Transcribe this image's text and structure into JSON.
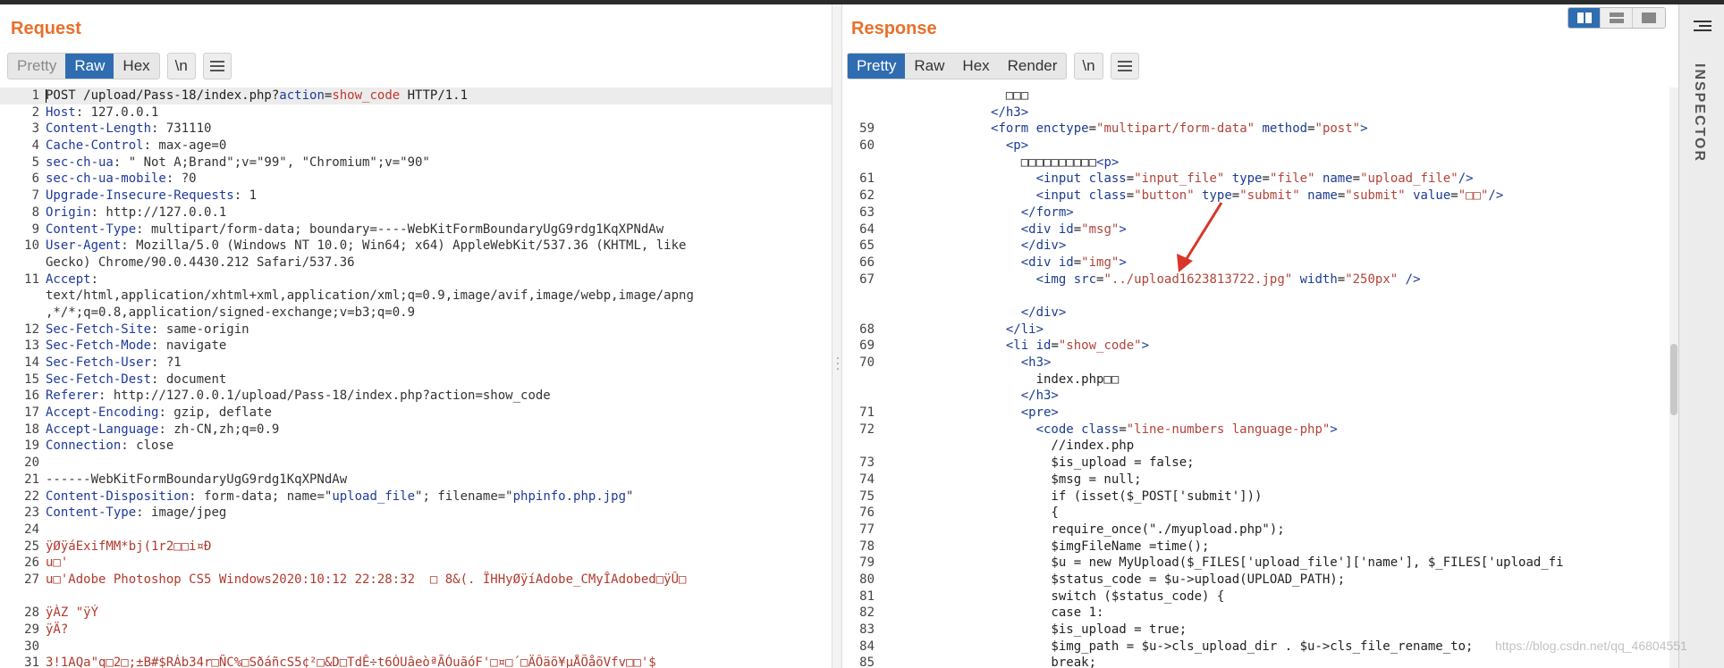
{
  "layout_buttons": [
    {
      "name": "split-horizontal",
      "active": true
    },
    {
      "name": "split-vertical",
      "active": false
    },
    {
      "name": "single",
      "active": false
    }
  ],
  "inspector": {
    "label": "INSPECTOR"
  },
  "request": {
    "title": "Request",
    "tabs": [
      "Pretty",
      "Raw",
      "Hex"
    ],
    "active_tab": "Raw",
    "newline_btn": "\\n",
    "lines": [
      {
        "n": "1",
        "hl": true,
        "cursor": true,
        "segs": [
          [
            "plain",
            "POST /upload/Pass-18/index.php?"
          ],
          [
            "pk",
            "action"
          ],
          [
            "plain",
            "="
          ],
          [
            "pv",
            "show_code"
          ],
          [
            "plain",
            " HTTP/1.1"
          ]
        ]
      },
      {
        "n": "2",
        "segs": [
          [
            "h",
            "Host"
          ],
          [
            "v",
            ": 127.0.0.1"
          ]
        ]
      },
      {
        "n": "3",
        "segs": [
          [
            "h",
            "Content-Length"
          ],
          [
            "v",
            ": 731110"
          ]
        ]
      },
      {
        "n": "4",
        "segs": [
          [
            "h",
            "Cache-Control"
          ],
          [
            "v",
            ": max-age=0"
          ]
        ]
      },
      {
        "n": "5",
        "segs": [
          [
            "h",
            "sec-ch-ua"
          ],
          [
            "v",
            ": \" Not A;Brand\";v=\"99\", \"Chromium\";v=\"90\""
          ]
        ]
      },
      {
        "n": "6",
        "segs": [
          [
            "h",
            "sec-ch-ua-mobile"
          ],
          [
            "v",
            ": ?0"
          ]
        ]
      },
      {
        "n": "7",
        "segs": [
          [
            "h",
            "Upgrade-Insecure-Requests"
          ],
          [
            "v",
            ": 1"
          ]
        ]
      },
      {
        "n": "8",
        "segs": [
          [
            "h",
            "Origin"
          ],
          [
            "v",
            ": http://127.0.0.1"
          ]
        ]
      },
      {
        "n": "9",
        "segs": [
          [
            "h",
            "Content-Type"
          ],
          [
            "v",
            ": multipart/form-data; boundary=----WebKitFormBoundaryUgG9rdg1KqXPNdAw"
          ]
        ]
      },
      {
        "n": "10",
        "segs": [
          [
            "h",
            "User-Agent"
          ],
          [
            "v",
            ": Mozilla/5.0 (Windows NT 10.0; Win64; x64) AppleWebKit/537.36 (KHTML, like"
          ]
        ]
      },
      {
        "n": "",
        "segs": [
          [
            "v",
            "Gecko) Chrome/90.0.4430.212 Safari/537.36"
          ]
        ]
      },
      {
        "n": "11",
        "segs": [
          [
            "h",
            "Accept"
          ],
          [
            "v",
            ":"
          ]
        ]
      },
      {
        "n": "",
        "segs": [
          [
            "v",
            "text/html,application/xhtml+xml,application/xml;q=0.9,image/avif,image/webp,image/apng"
          ]
        ]
      },
      {
        "n": "",
        "segs": [
          [
            "v",
            ",*/*;q=0.8,application/signed-exchange;v=b3;q=0.9"
          ]
        ]
      },
      {
        "n": "12",
        "segs": [
          [
            "h",
            "Sec-Fetch-Site"
          ],
          [
            "v",
            ": same-origin"
          ]
        ]
      },
      {
        "n": "13",
        "segs": [
          [
            "h",
            "Sec-Fetch-Mode"
          ],
          [
            "v",
            ": navigate"
          ]
        ]
      },
      {
        "n": "14",
        "segs": [
          [
            "h",
            "Sec-Fetch-User"
          ],
          [
            "v",
            ": ?1"
          ]
        ]
      },
      {
        "n": "15",
        "segs": [
          [
            "h",
            "Sec-Fetch-Dest"
          ],
          [
            "v",
            ": document"
          ]
        ]
      },
      {
        "n": "16",
        "segs": [
          [
            "h",
            "Referer"
          ],
          [
            "v",
            ": http://127.0.0.1/upload/Pass-18/index.php?action=show_code"
          ]
        ]
      },
      {
        "n": "17",
        "segs": [
          [
            "h",
            "Accept-Encoding"
          ],
          [
            "v",
            ": gzip, deflate"
          ]
        ]
      },
      {
        "n": "18",
        "segs": [
          [
            "h",
            "Accept-Language"
          ],
          [
            "v",
            ": zh-CN,zh;q=0.9"
          ]
        ]
      },
      {
        "n": "19",
        "segs": [
          [
            "h",
            "Connection"
          ],
          [
            "v",
            ": close"
          ]
        ]
      },
      {
        "n": "20",
        "segs": []
      },
      {
        "n": "21",
        "segs": [
          [
            "v",
            "------WebKitFormBoundaryUgG9rdg1KqXPNdAw"
          ]
        ]
      },
      {
        "n": "22",
        "segs": [
          [
            "h",
            "Content-Disposition"
          ],
          [
            "v",
            ": form-data; name=\""
          ],
          [
            "pk",
            "upload_file"
          ],
          [
            "v",
            "\"; filename=\""
          ],
          [
            "pk",
            "phpinfo.php.jpg"
          ],
          [
            "v",
            "\""
          ]
        ]
      },
      {
        "n": "23",
        "segs": [
          [
            "h",
            "Content-Type"
          ],
          [
            "v",
            ": image/jpeg"
          ]
        ]
      },
      {
        "n": "24",
        "segs": []
      },
      {
        "n": "25",
        "segs": [
          [
            "red",
            "ÿØÿáExifMM*bj(1r2□□i¤Ð"
          ]
        ]
      },
      {
        "n": "26",
        "segs": [
          [
            "red",
            "u□'"
          ]
        ]
      },
      {
        "n": "27",
        "segs": [
          [
            "red",
            "u□'Adobe Photoshop CS5 Windows2020:10:12 22:28:32  □ 8&(. ÏHHyØÿíAdobe_CMyÎAdobed□ÿÛ□"
          ]
        ]
      },
      {
        "n": "",
        "segs": []
      },
      {
        "n": "28",
        "segs": [
          [
            "red",
            "ÿÀZ \"ÿÝ"
          ]
        ]
      },
      {
        "n": "29",
        "segs": [
          [
            "red",
            "ÿÄ?"
          ]
        ]
      },
      {
        "n": "30",
        "segs": []
      },
      {
        "n": "31",
        "segs": [
          [
            "red",
            "3!1AQa\"q□2□;±B#$RÁb34r□ÑC%□SðáñcS5¢²□&D□TdÊ÷t6ÒUâeòªÃÓuãóF'□¤□´□ÄÔäõ¥µÅÕåõVfv□□'$"
          ]
        ]
      }
    ]
  },
  "response": {
    "title": "Response",
    "tabs": [
      "Pretty",
      "Raw",
      "Hex",
      "Render"
    ],
    "active_tab": "Pretty",
    "newline_btn": "\\n",
    "lines": [
      {
        "n": "",
        "segs": [
          [
            "plain",
            "                □□□"
          ]
        ]
      },
      {
        "n": "",
        "segs": [
          [
            "plain",
            "              "
          ],
          [
            "tg",
            "</h3>"
          ]
        ]
      },
      {
        "n": "59",
        "segs": [
          [
            "plain",
            "              "
          ],
          [
            "tg",
            "<form "
          ],
          [
            "tg",
            "enctype"
          ],
          [
            "plain",
            "="
          ],
          [
            "at",
            "\"multipart/form-data\""
          ],
          [
            "tg",
            " method"
          ],
          [
            "plain",
            "="
          ],
          [
            "at",
            "\"post\""
          ],
          [
            "tg",
            ">"
          ]
        ]
      },
      {
        "n": "60",
        "segs": [
          [
            "plain",
            "                "
          ],
          [
            "tg",
            "<p>"
          ]
        ]
      },
      {
        "n": "",
        "segs": [
          [
            "plain",
            "                  □□□□□□□□□□"
          ],
          [
            "tg",
            "<p>"
          ]
        ]
      },
      {
        "n": "61",
        "segs": [
          [
            "plain",
            "                    "
          ],
          [
            "tg",
            "<input "
          ],
          [
            "tg",
            "class"
          ],
          [
            "plain",
            "="
          ],
          [
            "at",
            "\"input_file\""
          ],
          [
            "tg",
            " type"
          ],
          [
            "plain",
            "="
          ],
          [
            "at",
            "\"file\""
          ],
          [
            "tg",
            " name"
          ],
          [
            "plain",
            "="
          ],
          [
            "at",
            "\"upload_file\""
          ],
          [
            "tg",
            "/>"
          ]
        ]
      },
      {
        "n": "62",
        "segs": [
          [
            "plain",
            "                    "
          ],
          [
            "tg",
            "<input "
          ],
          [
            "tg",
            "class"
          ],
          [
            "plain",
            "="
          ],
          [
            "at",
            "\"button\""
          ],
          [
            "tg",
            " type"
          ],
          [
            "plain",
            "="
          ],
          [
            "at",
            "\"submit\""
          ],
          [
            "tg",
            " name"
          ],
          [
            "plain",
            "="
          ],
          [
            "at",
            "\"submit\""
          ],
          [
            "tg",
            " value"
          ],
          [
            "plain",
            "="
          ],
          [
            "at",
            "\"□□\""
          ],
          [
            "tg",
            "/>"
          ]
        ]
      },
      {
        "n": "63",
        "segs": [
          [
            "plain",
            "                  "
          ],
          [
            "tg",
            "</form>"
          ]
        ]
      },
      {
        "n": "64",
        "segs": [
          [
            "plain",
            "                  "
          ],
          [
            "tg",
            "<div "
          ],
          [
            "tg",
            "id"
          ],
          [
            "plain",
            "="
          ],
          [
            "at",
            "\"msg\""
          ],
          [
            "tg",
            ">"
          ]
        ]
      },
      {
        "n": "65",
        "segs": [
          [
            "plain",
            "                  "
          ],
          [
            "tg",
            "</div>"
          ]
        ]
      },
      {
        "n": "66",
        "segs": [
          [
            "plain",
            "                  "
          ],
          [
            "tg",
            "<div "
          ],
          [
            "tg",
            "id"
          ],
          [
            "plain",
            "="
          ],
          [
            "at",
            "\"img\""
          ],
          [
            "tg",
            ">"
          ]
        ]
      },
      {
        "n": "67",
        "segs": [
          [
            "plain",
            "                    "
          ],
          [
            "tg",
            "<img "
          ],
          [
            "tg",
            "src"
          ],
          [
            "plain",
            "="
          ],
          [
            "at",
            "\"../upload1623813722.jpg\""
          ],
          [
            "tg",
            " width"
          ],
          [
            "plain",
            "="
          ],
          [
            "at",
            "\"250px\""
          ],
          [
            "tg",
            " />"
          ]
        ]
      },
      {
        "n": "",
        "segs": []
      },
      {
        "n": "",
        "segs": [
          [
            "plain",
            "                  "
          ],
          [
            "tg",
            "</div>"
          ]
        ]
      },
      {
        "n": "68",
        "segs": [
          [
            "plain",
            "                "
          ],
          [
            "tg",
            "</li>"
          ]
        ]
      },
      {
        "n": "69",
        "segs": [
          [
            "plain",
            "                "
          ],
          [
            "tg",
            "<li "
          ],
          [
            "tg",
            "id"
          ],
          [
            "plain",
            "="
          ],
          [
            "at",
            "\"show_code\""
          ],
          [
            "tg",
            ">"
          ]
        ]
      },
      {
        "n": "70",
        "segs": [
          [
            "plain",
            "                  "
          ],
          [
            "tg",
            "<h3>"
          ]
        ]
      },
      {
        "n": "",
        "segs": [
          [
            "plain",
            "                    index.php□□"
          ]
        ]
      },
      {
        "n": "",
        "segs": [
          [
            "plain",
            "                  "
          ],
          [
            "tg",
            "</h3>"
          ]
        ]
      },
      {
        "n": "71",
        "segs": [
          [
            "plain",
            "                  "
          ],
          [
            "tg",
            "<pre>"
          ]
        ]
      },
      {
        "n": "72",
        "segs": [
          [
            "plain",
            "                    "
          ],
          [
            "tg",
            "<code "
          ],
          [
            "tg",
            "class"
          ],
          [
            "plain",
            "="
          ],
          [
            "at",
            "\"line-numbers language-php\""
          ],
          [
            "tg",
            ">"
          ]
        ]
      },
      {
        "n": "",
        "segs": [
          [
            "plain",
            "                      //index.php"
          ]
        ]
      },
      {
        "n": "73",
        "segs": [
          [
            "plain",
            "                      $is_upload = false;"
          ]
        ]
      },
      {
        "n": "74",
        "segs": [
          [
            "plain",
            "                      $msg = null;"
          ]
        ]
      },
      {
        "n": "75",
        "segs": [
          [
            "plain",
            "                      if (isset($_POST['submit']))"
          ]
        ]
      },
      {
        "n": "76",
        "segs": [
          [
            "plain",
            "                      {"
          ]
        ]
      },
      {
        "n": "77",
        "segs": [
          [
            "plain",
            "                      require_once(\"./myupload.php\");"
          ]
        ]
      },
      {
        "n": "78",
        "segs": [
          [
            "plain",
            "                      $imgFileName =time();"
          ]
        ]
      },
      {
        "n": "79",
        "segs": [
          [
            "plain",
            "                      $u = new MyUpload($_FILES['upload_file']['name'], $_FILES['upload_fi"
          ]
        ]
      },
      {
        "n": "80",
        "segs": [
          [
            "plain",
            "                      $status_code = $u->upload(UPLOAD_PATH);"
          ]
        ]
      },
      {
        "n": "81",
        "segs": [
          [
            "plain",
            "                      switch ($status_code) {"
          ]
        ]
      },
      {
        "n": "82",
        "segs": [
          [
            "plain",
            "                      case 1:"
          ]
        ]
      },
      {
        "n": "83",
        "segs": [
          [
            "plain",
            "                      $is_upload = true;"
          ]
        ]
      },
      {
        "n": "84",
        "segs": [
          [
            "plain",
            "                      $img_path = $u->cls_upload_dir . $u->cls_file_rename_to;"
          ]
        ]
      },
      {
        "n": "85",
        "segs": [
          [
            "plain",
            "                      break;"
          ]
        ]
      }
    ]
  },
  "watermark": "https://blog.csdn.net/qq_46804551"
}
